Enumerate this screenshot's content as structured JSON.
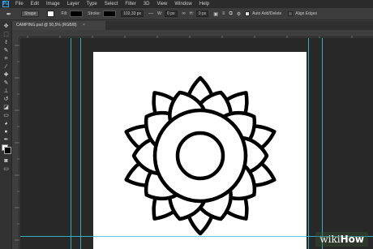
{
  "app": {
    "logo": "Ps"
  },
  "menu": [
    "File",
    "Edit",
    "Image",
    "Layer",
    "Type",
    "Select",
    "Filter",
    "3D",
    "View",
    "Window",
    "Help"
  ],
  "options": {
    "tool_icon": "pen-tool-icon",
    "mode": "Shape",
    "fill_label": "Fill:",
    "stroke_label": "Stroke:",
    "stroke_width": "102,33 px",
    "w_label": "W:",
    "w_value": "0 px",
    "h_label": "H:",
    "h_value": "0 px",
    "auto_add_delete": "Auto Add/Delete",
    "align_edges": "Align Edges"
  },
  "document_tab": {
    "title": "CAMPING.psd @ 50,5% (RGB/8)",
    "close": "×"
  },
  "tools": [
    "move-icon",
    "marquee-icon",
    "lasso-icon",
    "quick-select-icon",
    "crop-icon",
    "eyedropper-icon",
    "healing-icon",
    "brush-icon",
    "clone-stamp-icon",
    "history-brush-icon",
    "eraser-icon",
    "gradient-icon",
    "blur-icon",
    "dodge-icon",
    "pen-icon",
    "type-icon",
    "path-select-icon",
    "shape-icon",
    "hand-icon",
    "zoom-icon",
    "edit-toolbar-icon"
  ],
  "tool_glyphs": [
    "✥",
    "⬚",
    "ℓ",
    "✎",
    "⌗",
    "⁄",
    "✚",
    "✎",
    "⊥",
    "↺",
    "◪",
    "▭",
    "◕",
    "●",
    "✒",
    "T",
    "➤",
    "▢",
    "✋",
    "⌕",
    "⋯"
  ],
  "colors": {
    "foreground": "#000000",
    "background": "#ffffff",
    "guide": "#37c6d6"
  },
  "watermark": {
    "wiki": "wiki",
    "how": "How"
  }
}
